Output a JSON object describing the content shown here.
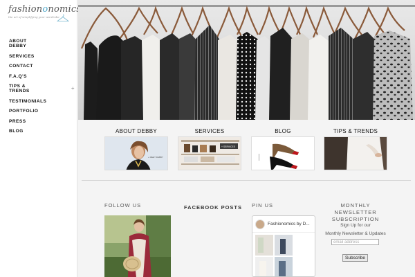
{
  "brand": {
    "logo_prefix": "fashion",
    "logo_highlight": "o",
    "logo_suffix": "nomics",
    "tagline": "the art of simplifying your wardrobe"
  },
  "nav": [
    {
      "label": "ABOUT\nDEBBY"
    },
    {
      "label": "SERVICES"
    },
    {
      "label": "CONTACT"
    },
    {
      "label": "F.A.Q'S"
    },
    {
      "label": "TIPS &\nTRENDS",
      "expand": "+"
    },
    {
      "label": "TESTIMONIALS"
    },
    {
      "label": "PORTFOLIO"
    },
    {
      "label": "PRESS"
    },
    {
      "label": "BLOG"
    }
  ],
  "quick_links": [
    {
      "title": "ABOUT DEBBY",
      "image_label": "Debby portrait"
    },
    {
      "title": "SERVICES",
      "image_label": "Closet shelves"
    },
    {
      "title": "BLOG",
      "image_label": "Red sole heels"
    },
    {
      "title": "TIPS & TRENDS",
      "image_label": "White blouse"
    }
  ],
  "services_badge": "+ SERVICES",
  "about_caption": "+ MEET DEBBY",
  "widgets": {
    "follow_title": "FOLLOW US",
    "facebook_title": "FACEBOOK POSTS",
    "pin_title": "PIN US",
    "pin_board_name": "Fashionomics by D...",
    "newsletter_title_1": "MONTHLY NEWSLETTER",
    "newsletter_title_2": "SUBSCRIPTION",
    "newsletter_line_1": "Sign Up for our",
    "newsletter_line_2": "Monthly Newsletter & Updates",
    "email_placeholder": "email address",
    "subscribe_label": "Subscribe"
  },
  "colors": {
    "accent": "#4da7c9",
    "background": "#f4f4f4",
    "sidebar": "#ffffff"
  }
}
